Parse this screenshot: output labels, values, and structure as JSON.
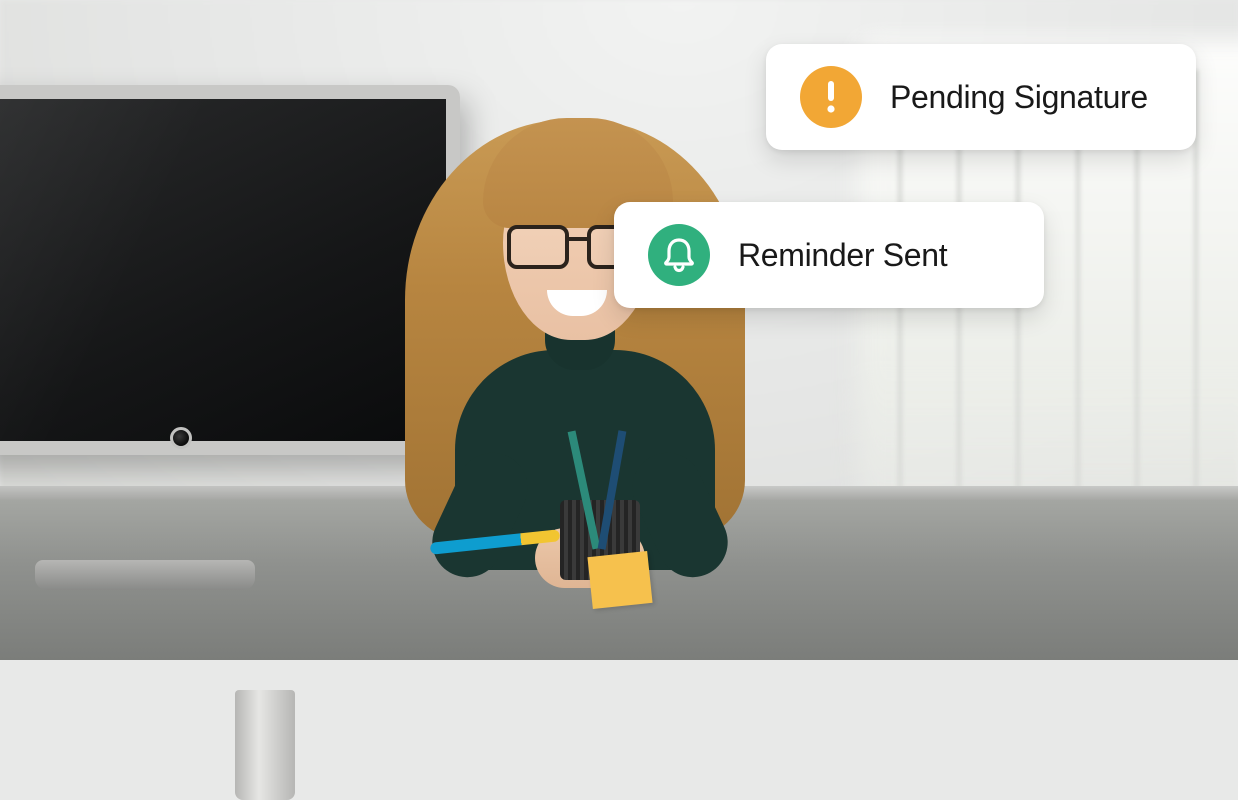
{
  "cards": {
    "pending": {
      "label": "Pending Signature",
      "icon_name": "alert-icon",
      "icon_color": "#f2a735"
    },
    "reminder": {
      "label": "Reminder Sent",
      "icon_name": "bell-icon",
      "icon_color": "#30b07e"
    }
  }
}
